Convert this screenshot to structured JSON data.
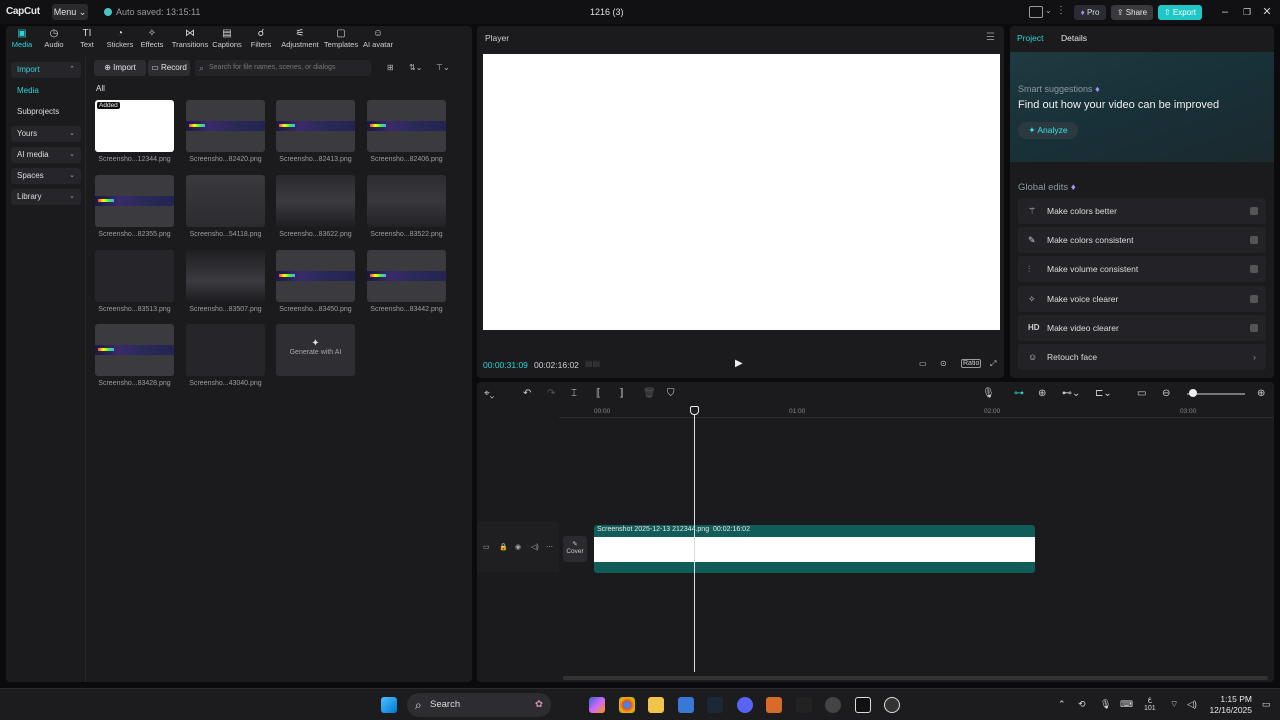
{
  "titlebar": {
    "logo": "CapCut",
    "menu_label": "Menu ⌄",
    "autosave": "Auto saved: 13:15:11",
    "project_title": "1216 (3)",
    "pro_label": "Pro",
    "share_label": "Share",
    "export_label": "Export"
  },
  "toolbar": {
    "items": [
      {
        "label": "Media",
        "icon": "media-icon"
      },
      {
        "label": "Audio",
        "icon": "audio-icon"
      },
      {
        "label": "Text",
        "icon": "text-icon"
      },
      {
        "label": "Stickers",
        "icon": "stickers-icon"
      },
      {
        "label": "Effects",
        "icon": "effects-icon"
      },
      {
        "label": "Transitions",
        "icon": "transitions-icon"
      },
      {
        "label": "Captions",
        "icon": "captions-icon"
      },
      {
        "label": "Filters",
        "icon": "filters-icon"
      },
      {
        "label": "Adjustment",
        "icon": "adjustment-icon"
      },
      {
        "label": "Templates",
        "icon": "templates-icon"
      },
      {
        "label": "AI avatar",
        "icon": "ai-avatar-icon"
      }
    ]
  },
  "sidebar": {
    "items": [
      {
        "label": "Import"
      },
      {
        "label": "Media"
      },
      {
        "label": "Subprojects"
      },
      {
        "label": "Yours"
      },
      {
        "label": "AI media"
      },
      {
        "label": "Spaces"
      },
      {
        "label": "Library"
      }
    ]
  },
  "media": {
    "import_label": "Import",
    "record_label": "Record",
    "search_placeholder": "Search for file names, scenes, or dialogs",
    "filter_label": "All",
    "added_badge": "Added",
    "files": [
      "Screensho...12344.png",
      "Screensho...82420.png",
      "Screensho...82413.png",
      "Screensho...82406.png",
      "Screensho...82355.png",
      "Screensho...54118.png",
      "Screensho...83622.png",
      "Screensho...83522.png",
      "Screensho...83513.png",
      "Screensho...83507.png",
      "Screensho...83450.png",
      "Screensho...83442.png",
      "Screensho...83428.png",
      "Screensho...43040.png"
    ],
    "generate_ai_label": "Generate with AI"
  },
  "player": {
    "title": "Player",
    "current_time": "00:00:31:09",
    "total_time": "00:02:16:02",
    "ratio_label": "Ratio"
  },
  "right_panel": {
    "tabs": [
      "Project",
      "Details"
    ],
    "smart_heading": "Smart suggestions",
    "smart_subtitle": "Find out how your video can be improved",
    "analyze_label": "Analyze",
    "global_edits_heading": "Global edits",
    "edits": [
      {
        "label": "Make colors better",
        "icon": "magic-wand-icon"
      },
      {
        "label": "Make colors consistent",
        "icon": "color-brush-icon"
      },
      {
        "label": "Make volume consistent",
        "icon": "sliders-icon"
      },
      {
        "label": "Make voice clearer",
        "icon": "sparkle-icon"
      },
      {
        "label": "Make video clearer",
        "icon": "hd-icon"
      },
      {
        "label": "Retouch face",
        "icon": "face-icon"
      }
    ],
    "hd_glyph": "HD"
  },
  "timeline": {
    "ruler": [
      "00:00",
      "01:00",
      "02:00",
      "03:00"
    ],
    "cover_label": "Cover",
    "clip_name": "Screenshot 2025-12-13 212344.png",
    "clip_duration": "00:02:16:02"
  },
  "taskbar": {
    "search_label": "Search",
    "lang_top": "ع",
    "lang_bottom": "101",
    "time": "1:15 PM",
    "date": "12/16/2025"
  },
  "colors": {
    "accent": "#2fd3d3",
    "export": "#1fc7c7",
    "clip": "#0f5c58",
    "panel": "#1b1b1e",
    "background": "#0b0b0d"
  }
}
